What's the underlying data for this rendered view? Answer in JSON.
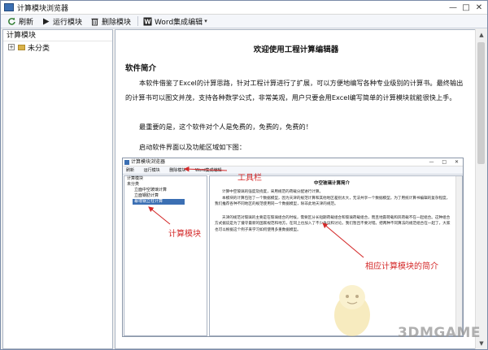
{
  "window": {
    "title": "计算模块浏览器",
    "controls": [
      "—",
      "□",
      "✕"
    ]
  },
  "toolbar": {
    "refresh_label": "刷新",
    "run_label": "运行模块",
    "delete_label": "删除模块",
    "word_label": "Word集成编辑"
  },
  "left_panel": {
    "header": "计算模块",
    "tree": [
      {
        "label": "未分类",
        "expander": "+"
      }
    ]
  },
  "document": {
    "title": "欢迎使用工程计算编辑器",
    "section_heading": "软件简介",
    "para1": "本软件借鉴了Excel的计算思路，针对工程计算进行了扩展，可以方便地编写各种专业级别的计算书。最终输出的计算书可以图文并茂，支持各种数学公式，非常美观，用户只要会用Excel编写简单的计算模块就能很快上手。",
    "para2": "最重要的是，这个软件对个人是免费的，免费的，免费的！",
    "para3": "启动软件界面以及功能区域如下图："
  },
  "embedded": {
    "title": "计算模块浏览器",
    "controls": "— □ ✕",
    "toolbar": [
      "刷新",
      "运行模块",
      "删除模块",
      "Word集成编辑"
    ],
    "tree_header": "计算模块",
    "tree_root": "未分类",
    "tree_items": [
      "立面中空玻璃计算",
      "立面钢肋计算",
      "幕墙钢立柱计算"
    ],
    "doc_title": "中空玻璃计算简介",
    "doc_paras": [
      "计算中空玻璃的强度及挠度，采用规范的荷载分配进行计算。",
      "本模块的计算包括了一个数据模型，因为天津的规范计算和其他地区差别太大，无法共享一个数据模型。为了用统计算书编辑的复杂程度，我们推荐各种不同地区的规范使用同一个数据模型，除非此地天津的规范。",
      "天津的规范对玻璃的主要是在玻璃组合的时候，需要区分长短期荷载组合和玻璃荷载组合，而且地震荷载和风荷载不在一起组合。这种组合方式据说是为了遵守最新的国家规范和地方，在同上也加入了不少争议和讨论。我们暂且不要对错。把两种不同算法的规范组合在一起了，大家也可以根据这个例子来学习如何使用多重数据模型。"
    ]
  },
  "annotations": {
    "toolbar": "工具栏",
    "module": "计算模块",
    "intro": "相应计算模块的简介"
  },
  "watermark": "3DMGAME",
  "colors": {
    "annotation": "#d42a2a",
    "selection": "#3b6fb3"
  }
}
